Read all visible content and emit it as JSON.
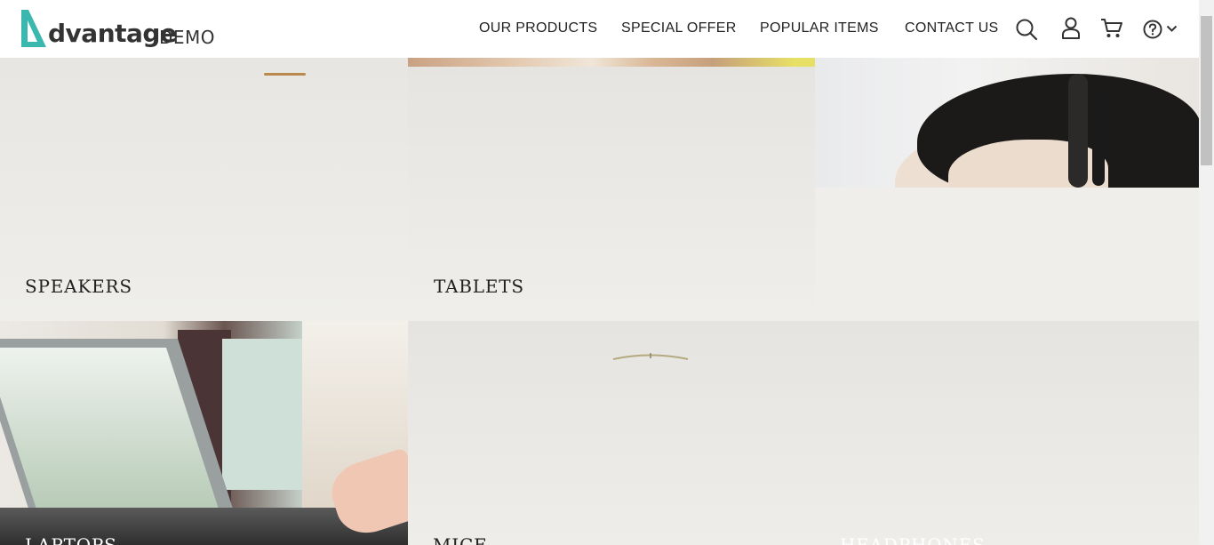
{
  "brand": {
    "name": "dvantage",
    "suffix": "DEMO",
    "accent": "#3ab8b0"
  },
  "nav": {
    "items": [
      "OUR PRODUCTS",
      "SPECIAL OFFER",
      "POPULAR ITEMS",
      "CONTACT US"
    ]
  },
  "icons": {
    "search": "search-icon",
    "user": "user-icon",
    "cart": "cart-icon",
    "help": "help-icon",
    "dropdown": "chevron-down-icon"
  },
  "categories": {
    "speakers": "SPEAKERS",
    "tablets": "TABLETS",
    "laptops": "LAPTOPS",
    "mice": "MICE",
    "headphones": "HEADPHONES"
  }
}
